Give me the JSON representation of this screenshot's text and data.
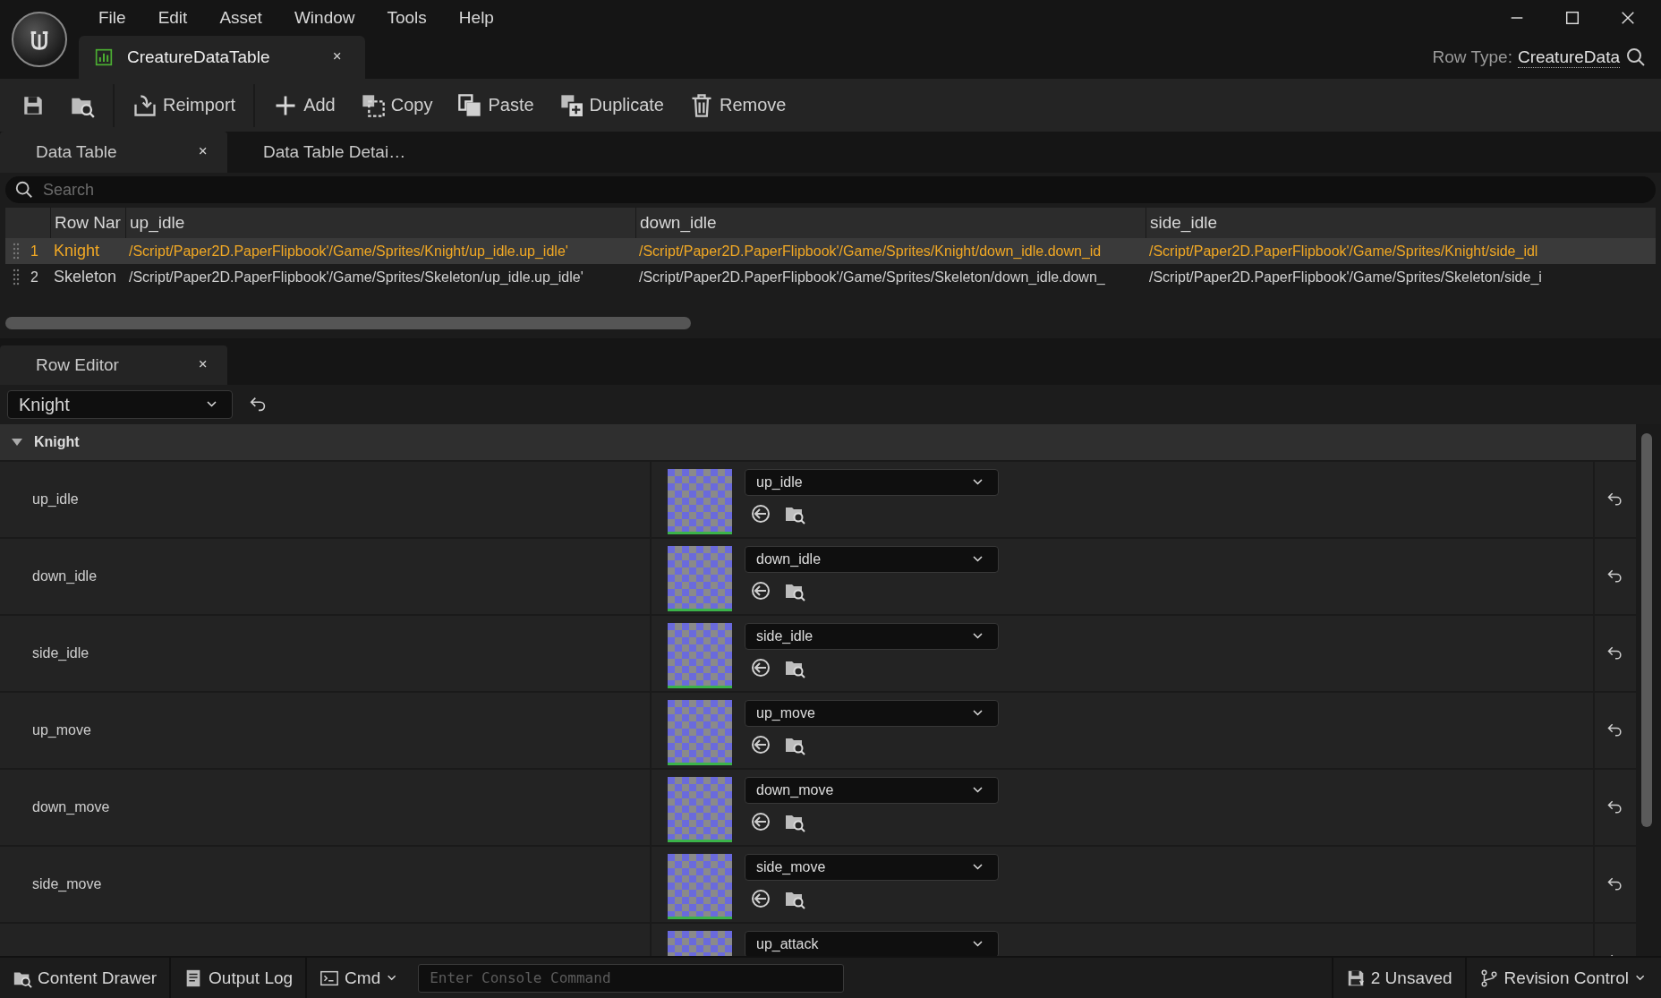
{
  "menu": [
    "File",
    "Edit",
    "Asset",
    "Window",
    "Tools",
    "Help"
  ],
  "document_tab": {
    "title": "CreatureDataTable"
  },
  "row_type": {
    "label": "Row Type:",
    "value": "CreatureData"
  },
  "toolbar": [
    "Reimport",
    "Add",
    "Copy",
    "Paste",
    "Duplicate",
    "Remove"
  ],
  "panel_tabs": [
    {
      "label": "Data Table",
      "selected": true,
      "closable": true
    },
    {
      "label": "Data Table Detai…",
      "selected": false,
      "closable": false
    }
  ],
  "search": {
    "placeholder": "Search"
  },
  "table": {
    "columns": [
      "",
      "Row Nar",
      "up_idle",
      "down_idle",
      "side_idle"
    ],
    "rows": [
      {
        "selected": true,
        "cells": [
          "1",
          "Knight",
          "/Script/Paper2D.PaperFlipbook'/Game/Sprites/Knight/up_idle.up_idle'",
          "/Script/Paper2D.PaperFlipbook'/Game/Sprites/Knight/down_idle.down_id",
          "/Script/Paper2D.PaperFlipbook'/Game/Sprites/Knight/side_idl"
        ]
      },
      {
        "selected": false,
        "cells": [
          "2",
          "Skeleton",
          "/Script/Paper2D.PaperFlipbook'/Game/Sprites/Skeleton/up_idle.up_idle'",
          "/Script/Paper2D.PaperFlipbook'/Game/Sprites/Skeleton/down_idle.down_",
          "/Script/Paper2D.PaperFlipbook'/Game/Sprites/Skeleton/side_i"
        ]
      }
    ]
  },
  "row_editor": {
    "tab": {
      "label": "Row Editor",
      "closable": true
    },
    "row_picker": {
      "value": "Knight"
    },
    "category": {
      "label": "Knight",
      "expanded": true
    },
    "properties": [
      {
        "name": "up_idle",
        "value": "up_idle"
      },
      {
        "name": "down_idle",
        "value": "down_idle"
      },
      {
        "name": "side_idle",
        "value": "side_idle"
      },
      {
        "name": "up_move",
        "value": "up_move"
      },
      {
        "name": "down_move",
        "value": "down_move"
      },
      {
        "name": "side_move",
        "value": "side_move"
      },
      {
        "value": "up_attack"
      }
    ]
  },
  "status_bar": {
    "content_drawer": "Content Drawer",
    "output_log": "Output Log",
    "cmd": "Cmd",
    "console": {
      "placeholder": "Enter Console Command"
    },
    "unsaved": "2 Unsaved",
    "revision_control": "Revision Control"
  }
}
